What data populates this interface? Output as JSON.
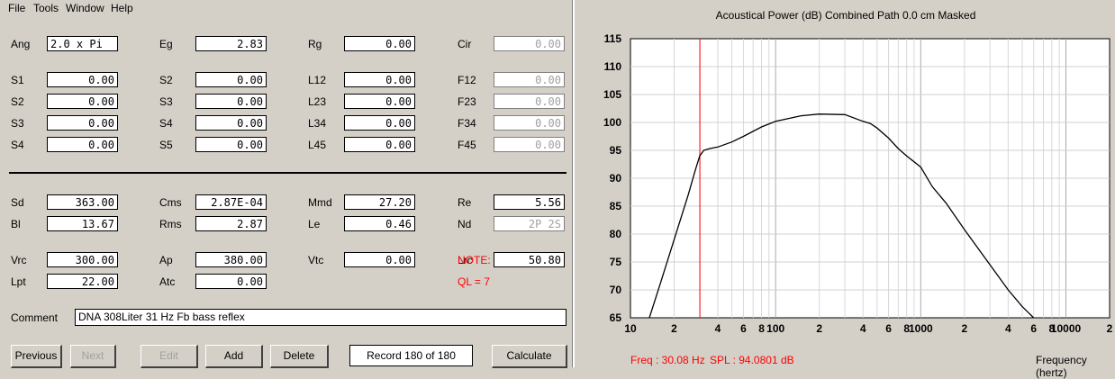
{
  "menu": [
    "File",
    "Tools",
    "Window",
    "Help"
  ],
  "params": [
    {
      "label": "Ang",
      "value": "2.0 x Pi",
      "disabled": false
    },
    {
      "label": "Eg",
      "value": "2.83",
      "disabled": false
    },
    {
      "label": "Rg",
      "value": "0.00",
      "disabled": false
    },
    {
      "label": "Cir",
      "value": "0.00",
      "disabled": true
    },
    {
      "label": "S1",
      "value": "0.00",
      "disabled": false
    },
    {
      "label": "S2",
      "value": "0.00",
      "disabled": false
    },
    {
      "label": "L12",
      "value": "0.00",
      "disabled": false
    },
    {
      "label": "F12",
      "value": "0.00",
      "disabled": true
    },
    {
      "label": "S2",
      "value": "0.00",
      "disabled": false
    },
    {
      "label": "S3",
      "value": "0.00",
      "disabled": false
    },
    {
      "label": "L23",
      "value": "0.00",
      "disabled": false
    },
    {
      "label": "F23",
      "value": "0.00",
      "disabled": true
    },
    {
      "label": "S3",
      "value": "0.00",
      "disabled": false
    },
    {
      "label": "S4",
      "value": "0.00",
      "disabled": false
    },
    {
      "label": "L34",
      "value": "0.00",
      "disabled": false
    },
    {
      "label": "F34",
      "value": "0.00",
      "disabled": true
    },
    {
      "label": "S4",
      "value": "0.00",
      "disabled": false
    },
    {
      "label": "S5",
      "value": "0.00",
      "disabled": false
    },
    {
      "label": "L45",
      "value": "0.00",
      "disabled": false
    },
    {
      "label": "F45",
      "value": "0.00",
      "disabled": true
    },
    {
      "label": "Sd",
      "value": "363.00",
      "disabled": false
    },
    {
      "label": "Cms",
      "value": "2.87E-04",
      "disabled": false
    },
    {
      "label": "Mmd",
      "value": "27.20",
      "disabled": false
    },
    {
      "label": "Re",
      "value": "5.56",
      "disabled": false
    },
    {
      "label": "Bl",
      "value": "13.67",
      "disabled": false
    },
    {
      "label": "Rms",
      "value": "2.87",
      "disabled": false
    },
    {
      "label": "Le",
      "value": "0.46",
      "disabled": false
    },
    {
      "label": "Nd",
      "value": "2P 2S",
      "disabled": true
    },
    {
      "label": "Vrc",
      "value": "300.00",
      "disabled": false
    },
    {
      "label": "Ap",
      "value": "380.00",
      "disabled": false
    },
    {
      "label": "Vtc",
      "value": "0.00",
      "disabled": false
    },
    {
      "label": "Lrc",
      "value": "50.80",
      "disabled": false
    },
    {
      "label": "Lpt",
      "value": "22.00",
      "disabled": false
    },
    {
      "label": "Atc",
      "value": "0.00",
      "disabled": false
    }
  ],
  "note": {
    "label": "NOTE:",
    "ql": "QL = 7"
  },
  "comment": {
    "label": "Comment",
    "value": "DNA 308Liter 31 Hz Fb bass reflex"
  },
  "buttons": {
    "previous": "Previous",
    "next": "Next",
    "edit": "Edit",
    "add": "Add",
    "delete": "Delete",
    "calculate": "Calculate"
  },
  "record": "Record 180 of 180",
  "status": {
    "freq": "Freq : 30.08 Hz",
    "spl": "SPL : 94.0801 dB",
    "xaxis": "Frequency (hertz)"
  },
  "colors": {
    "accent_red": "#ff0000",
    "panel": "#d4d0c8"
  },
  "chart_data": {
    "type": "line",
    "title": "Acoustical Power (dB)   Combined   Path 0.0 cm   Masked",
    "xlabel": "Frequency (hertz)",
    "ylabel": "",
    "xscale": "log",
    "xlim": [
      10,
      20000
    ],
    "ylim": [
      65,
      115
    ],
    "grid": true,
    "yticks": [
      "115",
      "110",
      "105",
      "100",
      "95",
      "90",
      "85",
      "80",
      "75",
      "70",
      "65"
    ],
    "xticks": [
      {
        "v": 10,
        "t": "10"
      },
      {
        "v": 20,
        "t": "2"
      },
      {
        "v": 40,
        "t": "4"
      },
      {
        "v": 60,
        "t": "6"
      },
      {
        "v": 80,
        "t": "8"
      },
      {
        "v": 100,
        "t": "100"
      },
      {
        "v": 200,
        "t": "2"
      },
      {
        "v": 400,
        "t": "4"
      },
      {
        "v": 600,
        "t": "6"
      },
      {
        "v": 800,
        "t": "8"
      },
      {
        "v": 1000,
        "t": "1000"
      },
      {
        "v": 2000,
        "t": "2"
      },
      {
        "v": 4000,
        "t": "4"
      },
      {
        "v": 6000,
        "t": "6"
      },
      {
        "v": 8000,
        "t": "8"
      },
      {
        "v": 10000,
        "t": "10000"
      },
      {
        "v": 20000,
        "t": "2"
      }
    ],
    "marker_freq": 30.08,
    "series": [
      {
        "x": [
          13.5,
          16,
          20,
          25,
          28,
          30,
          32,
          35,
          40,
          50,
          60,
          80,
          100,
          150,
          200,
          300,
          400,
          450,
          500,
          600,
          700,
          800,
          1000,
          1200,
          1500,
          2000,
          3000,
          4000,
          5000,
          6000,
          7000,
          8000
        ],
        "y": [
          65,
          71,
          79,
          87,
          91.5,
          94,
          95,
          95.3,
          95.6,
          96.5,
          97.5,
          99.2,
          100.2,
          101.2,
          101.5,
          101.4,
          100.2,
          99.8,
          99,
          97.2,
          95.3,
          94,
          92,
          88.5,
          85.5,
          80.8,
          74.5,
          70,
          67,
          65,
          63.5,
          62
        ]
      }
    ]
  }
}
